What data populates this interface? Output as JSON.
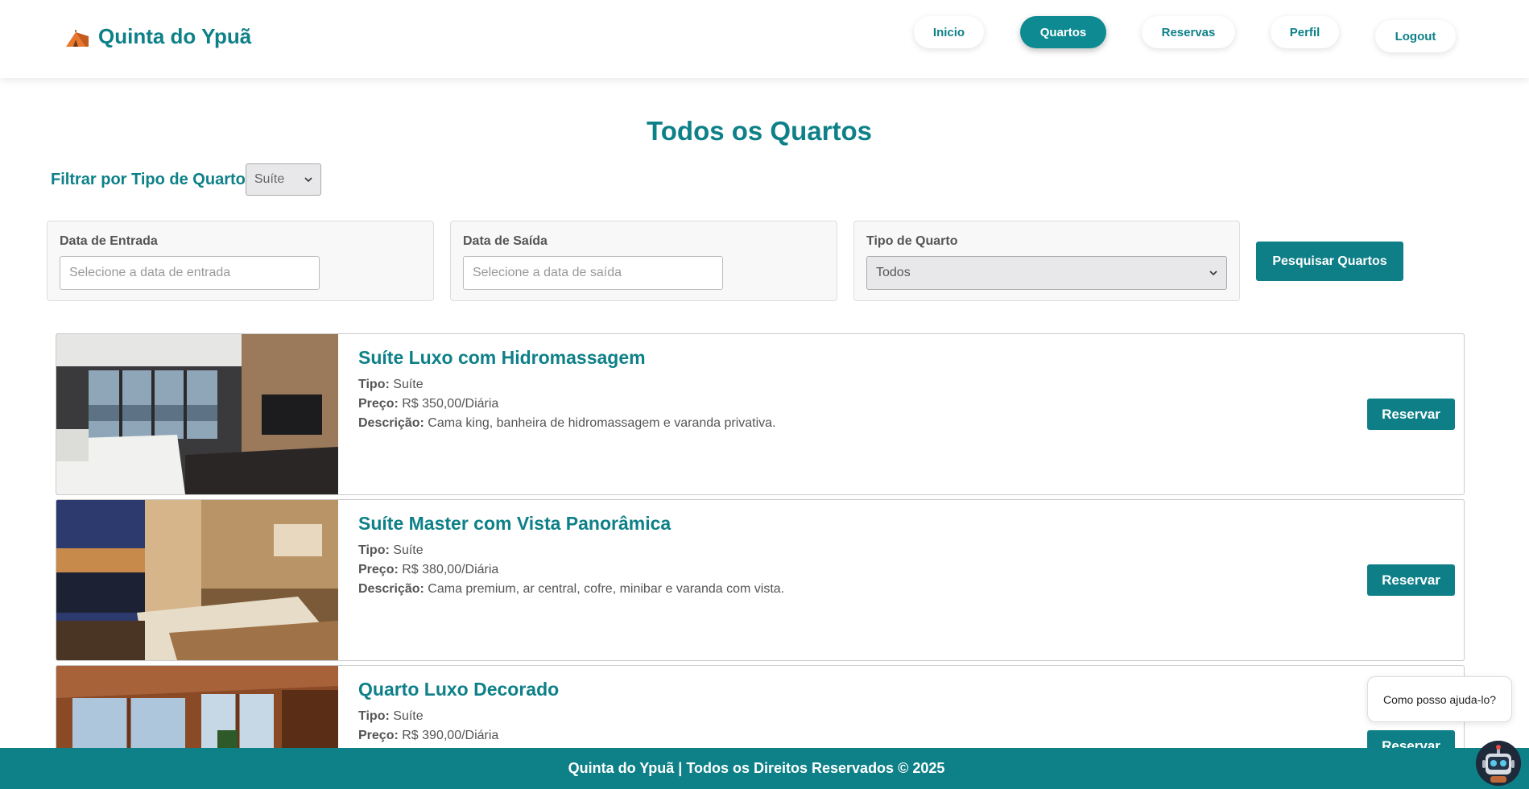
{
  "brand": {
    "name": "Quinta do Ypuã",
    "icon": "tent-icon"
  },
  "nav": {
    "inicio": "Inicio",
    "quartos": "Quartos",
    "reservas": "Reservas",
    "perfil": "Perfil",
    "logout": "Logout"
  },
  "page": {
    "title": "Todos os Quartos"
  },
  "filter": {
    "label": "Filtrar por Tipo de Quarto",
    "selected": "Suíte"
  },
  "search": {
    "checkin_label": "Data de Entrada",
    "checkin_placeholder": "Selecione a data de entrada",
    "checkout_label": "Data de Saída",
    "checkout_placeholder": "Selecione a data de saída",
    "type_label": "Tipo de Quarto",
    "type_selected": "Todos",
    "button": "Pesquisar Quartos"
  },
  "labels": {
    "tipo": "Tipo:",
    "preco": "Preço:",
    "descricao": "Descrição:",
    "reservar": "Reservar"
  },
  "rooms": [
    {
      "title": "Suíte Luxo com Hidromassagem",
      "tipo": "Suíte",
      "preco": "R$ 350,00/Diária",
      "descricao": "Cama king, banheira de hidromassagem e varanda privativa."
    },
    {
      "title": "Suíte Master com Vista Panorâmica",
      "tipo": "Suíte",
      "preco": "R$ 380,00/Diária",
      "descricao": "Cama premium, ar central, cofre, minibar e varanda com vista."
    },
    {
      "title": "Quarto Luxo Decorado",
      "tipo": "Suíte",
      "preco": "R$ 390,00/Diária"
    }
  ],
  "footer": {
    "text": "Quinta do Ypuã | Todos os Direitos Reservados © 2025"
  },
  "chat": {
    "bubble": "Como posso ajuda-lo?",
    "icon": "robot-icon"
  },
  "colors": {
    "primary": "#0e8088",
    "button": "#0e7f87"
  }
}
